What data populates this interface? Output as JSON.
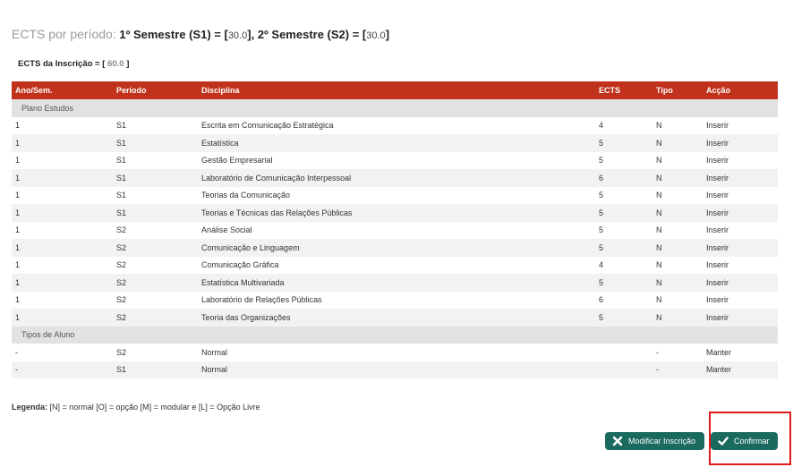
{
  "ects_summary": {
    "label": "ECTS por período:",
    "s1_label": "1º Semestre (S1) = [",
    "s1_value": "30.0",
    "s1_close": "],",
    "s2_label": "2º Semestre (S2) = [",
    "s2_value": "30.0",
    "s2_close": "]"
  },
  "inscription": {
    "label": "ECTS da Inscrição = [",
    "value": "60.0",
    "close": "]"
  },
  "table": {
    "headers": [
      "Ano/Sem.",
      "Período",
      "Disciplina",
      "ECTS",
      "Tipo",
      "Acção"
    ],
    "groups": [
      {
        "name": "Plano Estudos",
        "rows": [
          [
            "1",
            "S1",
            "Escrita em Comunicação Estratégica",
            "4",
            "N",
            "Inserir"
          ],
          [
            "1",
            "S1",
            "Estatística",
            "5",
            "N",
            "Inserir"
          ],
          [
            "1",
            "S1",
            "Gestão Empresarial",
            "5",
            "N",
            "Inserir"
          ],
          [
            "1",
            "S1",
            "Laboratório de Comunicação Interpessoal",
            "6",
            "N",
            "Inserir"
          ],
          [
            "1",
            "S1",
            "Teorias da Comunicação",
            "5",
            "N",
            "Inserir"
          ],
          [
            "1",
            "S1",
            "Teorias e Técnicas das Relações Públicas",
            "5",
            "N",
            "Inserir"
          ],
          [
            "1",
            "S2",
            "Análise Social",
            "5",
            "N",
            "Inserir"
          ],
          [
            "1",
            "S2",
            "Comunicação e Linguagem",
            "5",
            "N",
            "Inserir"
          ],
          [
            "1",
            "S2",
            "Comunicação Gráfica",
            "4",
            "N",
            "Inserir"
          ],
          [
            "1",
            "S2",
            "Estatística Multivariada",
            "5",
            "N",
            "Inserir"
          ],
          [
            "1",
            "S2",
            "Laboratório de Relações Públicas",
            "6",
            "N",
            "Inserir"
          ],
          [
            "1",
            "S2",
            "Teoria das Organizações",
            "5",
            "N",
            "Inserir"
          ]
        ]
      },
      {
        "name": "Tipos de Aluno",
        "rows": [
          [
            "-",
            "S2",
            "Normal",
            "",
            "-",
            "Manter"
          ],
          [
            "-",
            "S1",
            "Normal",
            "",
            "-",
            "Manter"
          ]
        ]
      }
    ]
  },
  "legend": {
    "label": "Legenda:",
    "text": "[N] = normal [O] = opção [M] = modular e [L] = Opção Livre"
  },
  "buttons": {
    "modify": "Modificar Inscrição",
    "confirm": "Confirmar"
  },
  "colors": {
    "header_bg": "#c0321b",
    "button_bg": "#1b6a60",
    "highlight": "#e0191b"
  }
}
